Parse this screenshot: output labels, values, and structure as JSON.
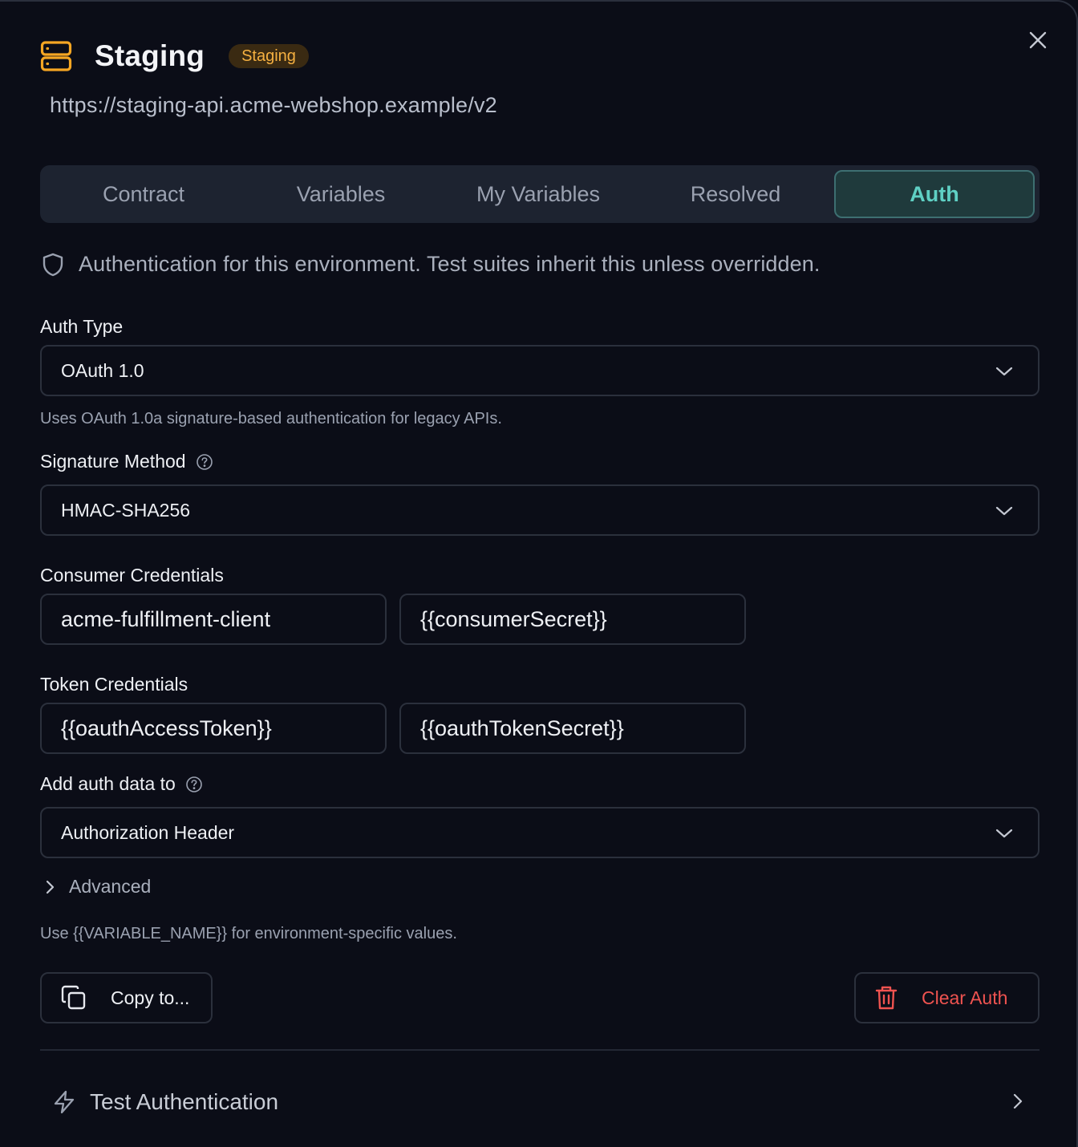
{
  "header": {
    "title": "Staging",
    "badge": "Staging",
    "url": "https://staging-api.acme-webshop.example/v2",
    "icon": "server-icon",
    "accent_color": "#f5a623"
  },
  "tabs": [
    {
      "label": "Contract",
      "active": false
    },
    {
      "label": "Variables",
      "active": false
    },
    {
      "label": "My Variables",
      "active": false
    },
    {
      "label": "Resolved",
      "active": false
    },
    {
      "label": "Auth",
      "active": true
    }
  ],
  "info": {
    "icon": "shield-icon",
    "text": "Authentication for this environment. Test suites inherit this unless overridden."
  },
  "auth_type": {
    "label": "Auth Type",
    "value": "OAuth 1.0",
    "hint": "Uses OAuth 1.0a signature-based authentication for legacy APIs."
  },
  "signature_method": {
    "label": "Signature Method",
    "value": "HMAC-SHA256"
  },
  "consumer_credentials": {
    "label": "Consumer Credentials",
    "key": "acme-fulfillment-client",
    "secret": "{{consumerSecret}}"
  },
  "token_credentials": {
    "label": "Token Credentials",
    "token": "{{oauthAccessToken}}",
    "secret": "{{oauthTokenSecret}}"
  },
  "add_auth_to": {
    "label": "Add auth data to",
    "value": "Authorization Header"
  },
  "advanced": {
    "label": "Advanced"
  },
  "variable_hint": "Use {{VARIABLE_NAME}} for environment-specific values.",
  "actions": {
    "copy_label": "Copy to...",
    "clear_label": "Clear Auth",
    "danger_color": "#ef5350"
  },
  "test": {
    "label": "Test Authentication"
  }
}
